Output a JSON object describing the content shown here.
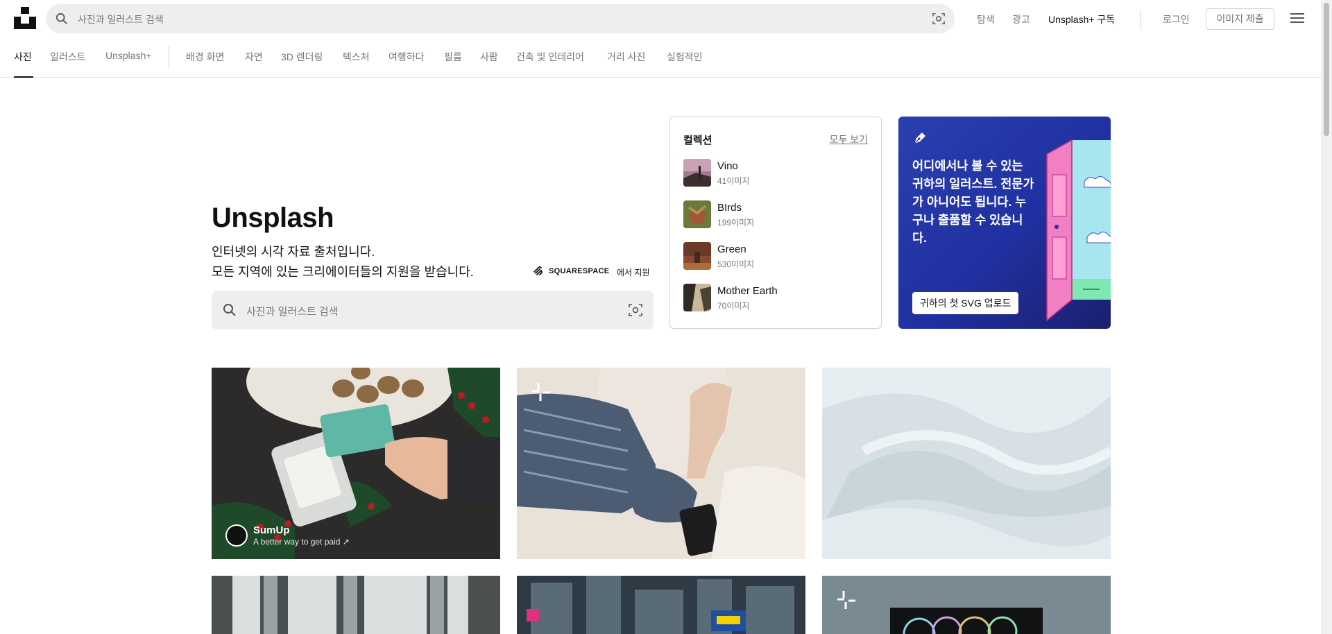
{
  "header": {
    "search_placeholder": "사진과 일러스트 검색",
    "links": [
      "탐색",
      "광고"
    ],
    "plus_link": "Unsplash+ 구독",
    "login": "로그인",
    "submit": "이미지 제출"
  },
  "tabs": {
    "items": [
      "사진",
      "일러스트",
      "Unsplash+",
      "배경 화면",
      "자연",
      "3D 렌더링",
      "텍스처",
      "여행하다",
      "필름",
      "사람",
      "건축 및 인테리어",
      "거리 사진",
      "실험적인"
    ],
    "active": "사진"
  },
  "hero": {
    "title": "Unsplash",
    "line1": "인터넷의 시각 자료 출처입니다.",
    "line2": "모든 지역에 있는 크리에이터들의 지원을 받습니다.",
    "sponsor_brand": "SQUARESPACE",
    "sponsor_suffix": "에서 지원",
    "search_placeholder": "사진과 일러스트 검색"
  },
  "collections": {
    "title": "컬렉션",
    "see_all": "모두 보기",
    "items": [
      {
        "name": "Vino",
        "count": "41이미지"
      },
      {
        "name": "BIrds",
        "count": "199이미지"
      },
      {
        "name": "Green",
        "count": "530이미지"
      },
      {
        "name": "Mother Earth",
        "count": "70이미지"
      }
    ]
  },
  "promo": {
    "text": "어디에서나 볼 수 있는 귀하의 일러스트. 전문가가 아니어도 됩니다. 누구나 출품할 수 있습니다.",
    "button": "귀하의 첫 SVG 업로드"
  },
  "photos": {
    "sponsor_name": "SumUp",
    "sponsor_tagline": "A better way to get paid ↗"
  },
  "colors": {
    "accent_text": "#111111",
    "muted_text": "#767676",
    "promo_bg": "#2030a0"
  }
}
